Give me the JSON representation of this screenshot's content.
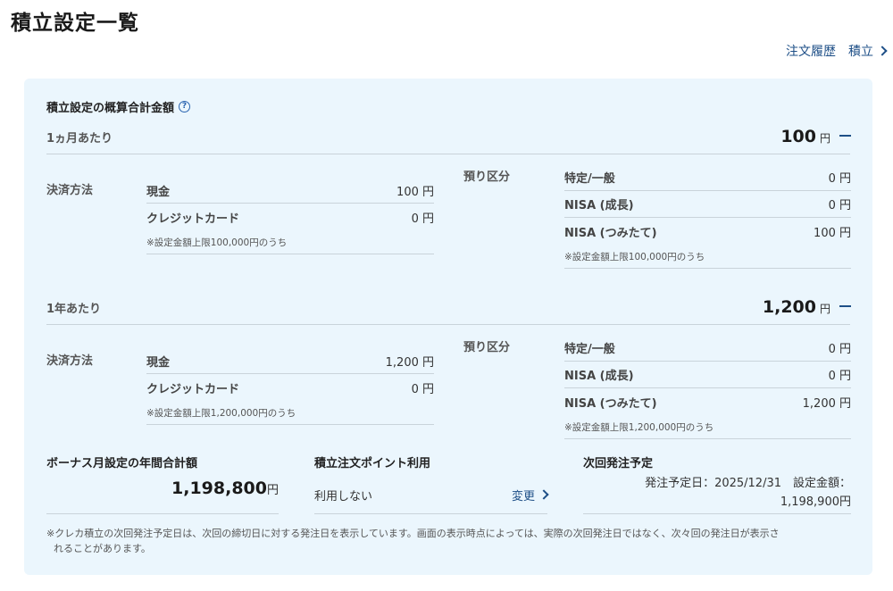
{
  "page": {
    "title": "積立設定一覧",
    "links": [
      {
        "label": "注文履歴"
      },
      {
        "label": "積立"
      }
    ]
  },
  "summary": {
    "title": "積立設定の概算合計金額",
    "help_glyph": "?",
    "yen": "円",
    "settlement_label": "決済方法",
    "custody_label": "預り区分",
    "monthly": {
      "label": "1ヵ月あたり",
      "total": "100",
      "settlement": [
        {
          "name": "現金",
          "amount": "100 円"
        },
        {
          "name": "クレジットカード",
          "amount": "0 円"
        }
      ],
      "settlement_note": "※設定金額上限100,000円のうち",
      "custody": [
        {
          "name": "特定/一般",
          "amount": "0 円"
        },
        {
          "name": "NISA (成長)",
          "amount": "0 円"
        },
        {
          "name": "NISA (つみたて)",
          "amount": "100 円"
        }
      ],
      "custody_note": "※設定金額上限100,000円のうち"
    },
    "yearly": {
      "label": "1年あたり",
      "total": "1,200",
      "settlement": [
        {
          "name": "現金",
          "amount": "1,200 円"
        },
        {
          "name": "クレジットカード",
          "amount": "0 円"
        }
      ],
      "settlement_note": "※設定金額上限1,200,000円のうち",
      "custody": [
        {
          "name": "特定/一般",
          "amount": "0 円"
        },
        {
          "name": "NISA (成長)",
          "amount": "0 円"
        },
        {
          "name": "NISA (つみたて)",
          "amount": "1,200 円"
        }
      ],
      "custody_note": "※設定金額上限1,200,000円のうち"
    },
    "bonus": {
      "title": "ボーナス月設定の年間合計額",
      "amount": "1,198,800",
      "yen": "円"
    },
    "points": {
      "title": "積立注文ポイント利用",
      "value": "利用しない",
      "change": "変更"
    },
    "next_order": {
      "title": "次回発注予定",
      "line1": "発注予定日：2025/12/31　設定金額：",
      "line2": "1,198,900円"
    },
    "footnote_1": "※クレカ積立の次回発注予定日は、次回の締切日に対する発注日を表示しています。画面の表示時点によっては、実際の次回発注日ではなく、次々回の発注日が表示さ",
    "footnote_2": "れることがあります。"
  }
}
